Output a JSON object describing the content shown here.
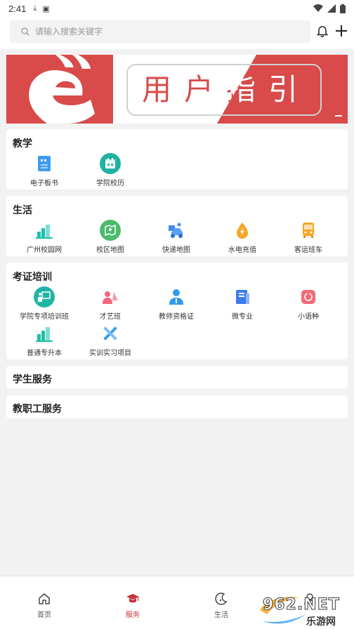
{
  "status_bar": {
    "time": "2:41"
  },
  "search": {
    "placeholder": "请输入搜索关键字"
  },
  "banner": {
    "text": "用户指引"
  },
  "sections": [
    {
      "title": "教学",
      "items": [
        {
          "label": "电子板书",
          "icon": "e-blackboard-icon",
          "color": "#3d9cf0"
        },
        {
          "label": "学院校历",
          "icon": "calendar-icon",
          "color": "#20b2a0"
        }
      ]
    },
    {
      "title": "生活",
      "items": [
        {
          "label": "广州校园网",
          "icon": "campus-network-icon",
          "color": "#1fbfb0"
        },
        {
          "label": "校区地图",
          "icon": "map-icon",
          "color": "#4cbb6c"
        },
        {
          "label": "快递地图",
          "icon": "delivery-icon",
          "color": "#3d8cf0"
        },
        {
          "label": "水电充值",
          "icon": "water-drop-icon",
          "color": "#f5a623"
        },
        {
          "label": "客运班车",
          "icon": "bus-icon",
          "color": "#f5a623"
        }
      ]
    },
    {
      "title": "考证培训",
      "items": [
        {
          "label": "学院专项培训班",
          "icon": "training-class-icon",
          "color": "#1fb5a5"
        },
        {
          "label": "才艺班",
          "icon": "talent-icon",
          "color": "#f06a7a"
        },
        {
          "label": "教师资格证",
          "icon": "teacher-cert-icon",
          "color": "#2e9bf0"
        },
        {
          "label": "微专业",
          "icon": "micro-major-icon",
          "color": "#3d7cf0"
        },
        {
          "label": "小语种",
          "icon": "language-icon",
          "color": "#f26b7a"
        },
        {
          "label": "普通专升本",
          "icon": "upgrade-icon",
          "color": "#1fbfa5"
        },
        {
          "label": "实训实习项目",
          "icon": "tools-icon",
          "color": "#3d9cf0"
        }
      ]
    },
    {
      "title": "学生服务",
      "items": []
    },
    {
      "title": "教职工服务",
      "items": []
    }
  ],
  "bottom_nav": [
    {
      "label": "首页",
      "icon": "home-icon",
      "active": false
    },
    {
      "label": "服务",
      "icon": "graduation-cap-icon",
      "active": true
    },
    {
      "label": "生活",
      "icon": "moon-icon",
      "active": false
    },
    {
      "label": "",
      "icon": "profile-icon",
      "active": false
    }
  ],
  "watermark": {
    "brand": "962.NET",
    "sub": "乐游网"
  },
  "colors": {
    "accent": "#c8323c",
    "banner_red": "#d94a4a"
  }
}
